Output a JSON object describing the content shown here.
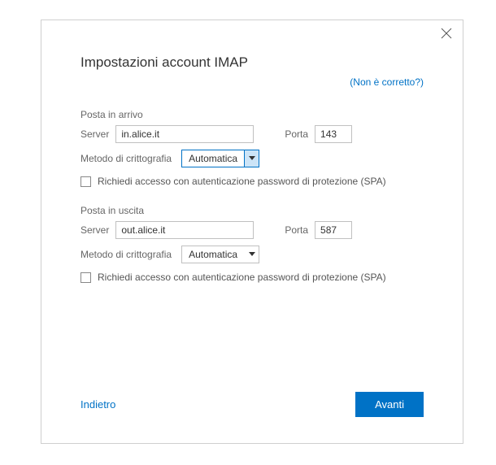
{
  "title": "Impostazioni account IMAP",
  "help_link": "(Non è corretto?)",
  "incoming": {
    "section_label": "Posta in arrivo",
    "server_label": "Server",
    "server_value": "in.alice.it",
    "port_label": "Porta",
    "port_value": "143",
    "encryption_label": "Metodo di crittografia",
    "encryption_value": "Automatica",
    "spa_label": "Richiedi accesso con autenticazione password di protezione (SPA)"
  },
  "outgoing": {
    "section_label": "Posta in uscita",
    "server_label": "Server",
    "server_value": "out.alice.it",
    "port_label": "Porta",
    "port_value": "587",
    "encryption_label": "Metodo di crittografia",
    "encryption_value": "Automatica",
    "spa_label": "Richiedi accesso con autenticazione password di protezione (SPA)"
  },
  "footer": {
    "back": "Indietro",
    "next": "Avanti"
  }
}
